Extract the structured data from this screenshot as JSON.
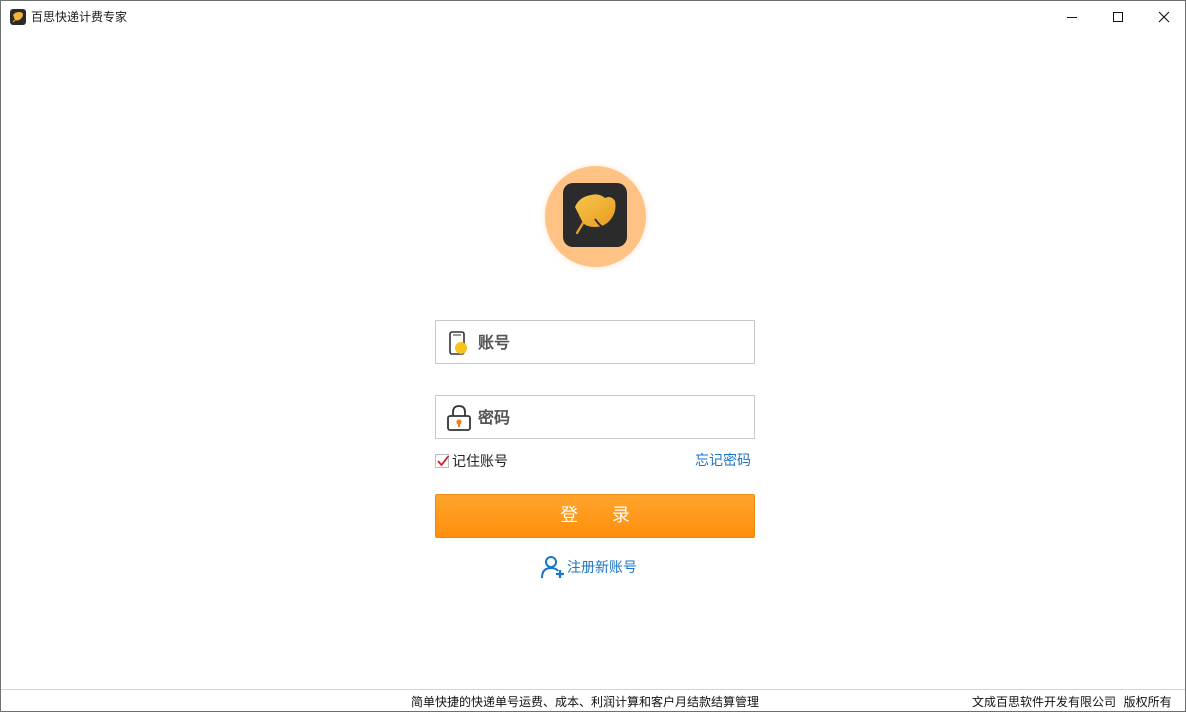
{
  "window": {
    "title": "百思快递计费专家"
  },
  "login": {
    "account_placeholder": "账号",
    "password_placeholder": "密码",
    "remember_label": "记住账号",
    "remember_checked": true,
    "forgot_label": "忘记密码",
    "login_label": "登 录",
    "register_label": "注册新账号"
  },
  "statusbar": {
    "description": "简单快捷的快递单号运费、成本、利润计算和客户月结款结算管理",
    "copyright": "文成百思软件开发有限公司  版权所有"
  },
  "colors": {
    "accent": "#ff9a1f",
    "link": "#1a74c8",
    "logo_bg": "#ffc285"
  },
  "icons": {
    "app": "ginkgo-leaf-icon",
    "account": "phone-icon",
    "password": "lock-icon",
    "register": "add-user-icon"
  }
}
